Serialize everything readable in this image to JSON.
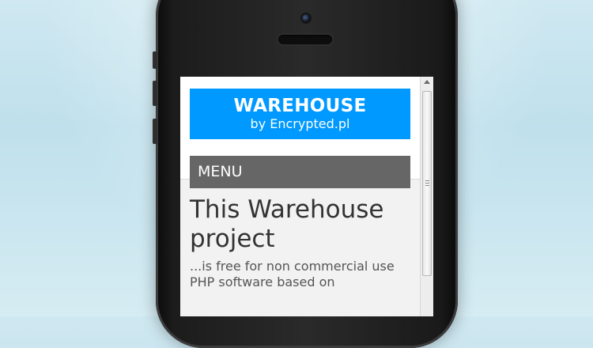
{
  "site": {
    "title": "WAREHOUSE",
    "subtitle": "by Encrypted.pl",
    "menu_label": "MENU"
  },
  "content": {
    "heading_line1": "This Warehouse",
    "heading_line2": "project",
    "paragraph_line1": "...is free for non commercial use",
    "paragraph_line2": "PHP software based on"
  },
  "colors": {
    "logo_bg": "#0099ff",
    "menu_bg": "#666666",
    "page_bg": "#f2f2f2"
  }
}
